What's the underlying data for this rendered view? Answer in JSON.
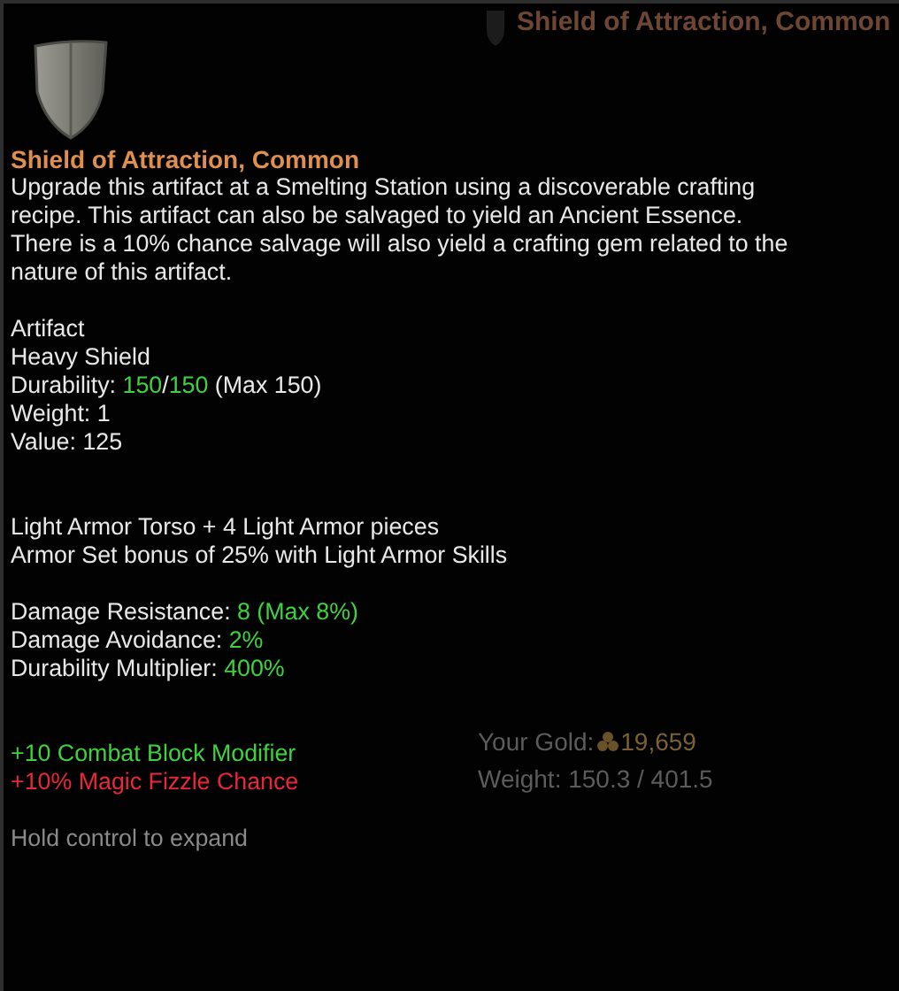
{
  "background": {
    "item_title": "Shield of Attraction, Common",
    "gold_label": "Your Gold:",
    "gold_value": "19,659",
    "weight": "Weight: 150.3 / 401.5"
  },
  "tooltip": {
    "title": "Shield of Attraction, Common",
    "description": [
      "Upgrade this artifact at a Smelting Station using a discoverable crafting",
      "recipe. This artifact can also be salvaged to yield an Ancient Essence.",
      "There is a 10% chance salvage will also yield a crafting gem related to the",
      "nature of this artifact."
    ],
    "groups": [
      {
        "lines": [
          [
            {
              "text": "Artifact",
              "kind": "plain"
            }
          ],
          [
            {
              "text": "Heavy Shield",
              "kind": "plain"
            }
          ],
          [
            {
              "text": "Durability: ",
              "kind": "plain"
            },
            {
              "text": "150",
              "kind": "good"
            },
            {
              "text": "/",
              "kind": "plain"
            },
            {
              "text": "150",
              "kind": "good"
            },
            {
              "text": " (Max 150)",
              "kind": "plain"
            }
          ],
          [
            {
              "text": "Weight: 1",
              "kind": "plain"
            }
          ],
          [
            {
              "text": "Value: 125",
              "kind": "plain"
            }
          ]
        ]
      },
      {
        "lines": [
          [
            {
              "text": "Light Armor Torso + 4 Light Armor pieces",
              "kind": "plain"
            }
          ],
          [
            {
              "text": "Armor Set bonus of 25% with Light Armor Skills",
              "kind": "plain"
            }
          ]
        ]
      },
      {
        "lines": [
          [
            {
              "text": "Damage Resistance: ",
              "kind": "plain"
            },
            {
              "text": "8 (Max 8%)",
              "kind": "good"
            }
          ],
          [
            {
              "text": "Damage Avoidance: ",
              "kind": "plain"
            },
            {
              "text": "2%",
              "kind": "good"
            }
          ],
          [
            {
              "text": "Durability Multiplier: ",
              "kind": "plain"
            },
            {
              "text": "400%",
              "kind": "good"
            }
          ]
        ]
      },
      {
        "lines": [
          [
            {
              "text": "+10 Combat Block Modifier",
              "kind": "good"
            }
          ],
          [
            {
              "text": "+10% Magic Fizzle Chance",
              "kind": "bad"
            }
          ]
        ]
      }
    ],
    "hint": "Hold control to expand"
  }
}
